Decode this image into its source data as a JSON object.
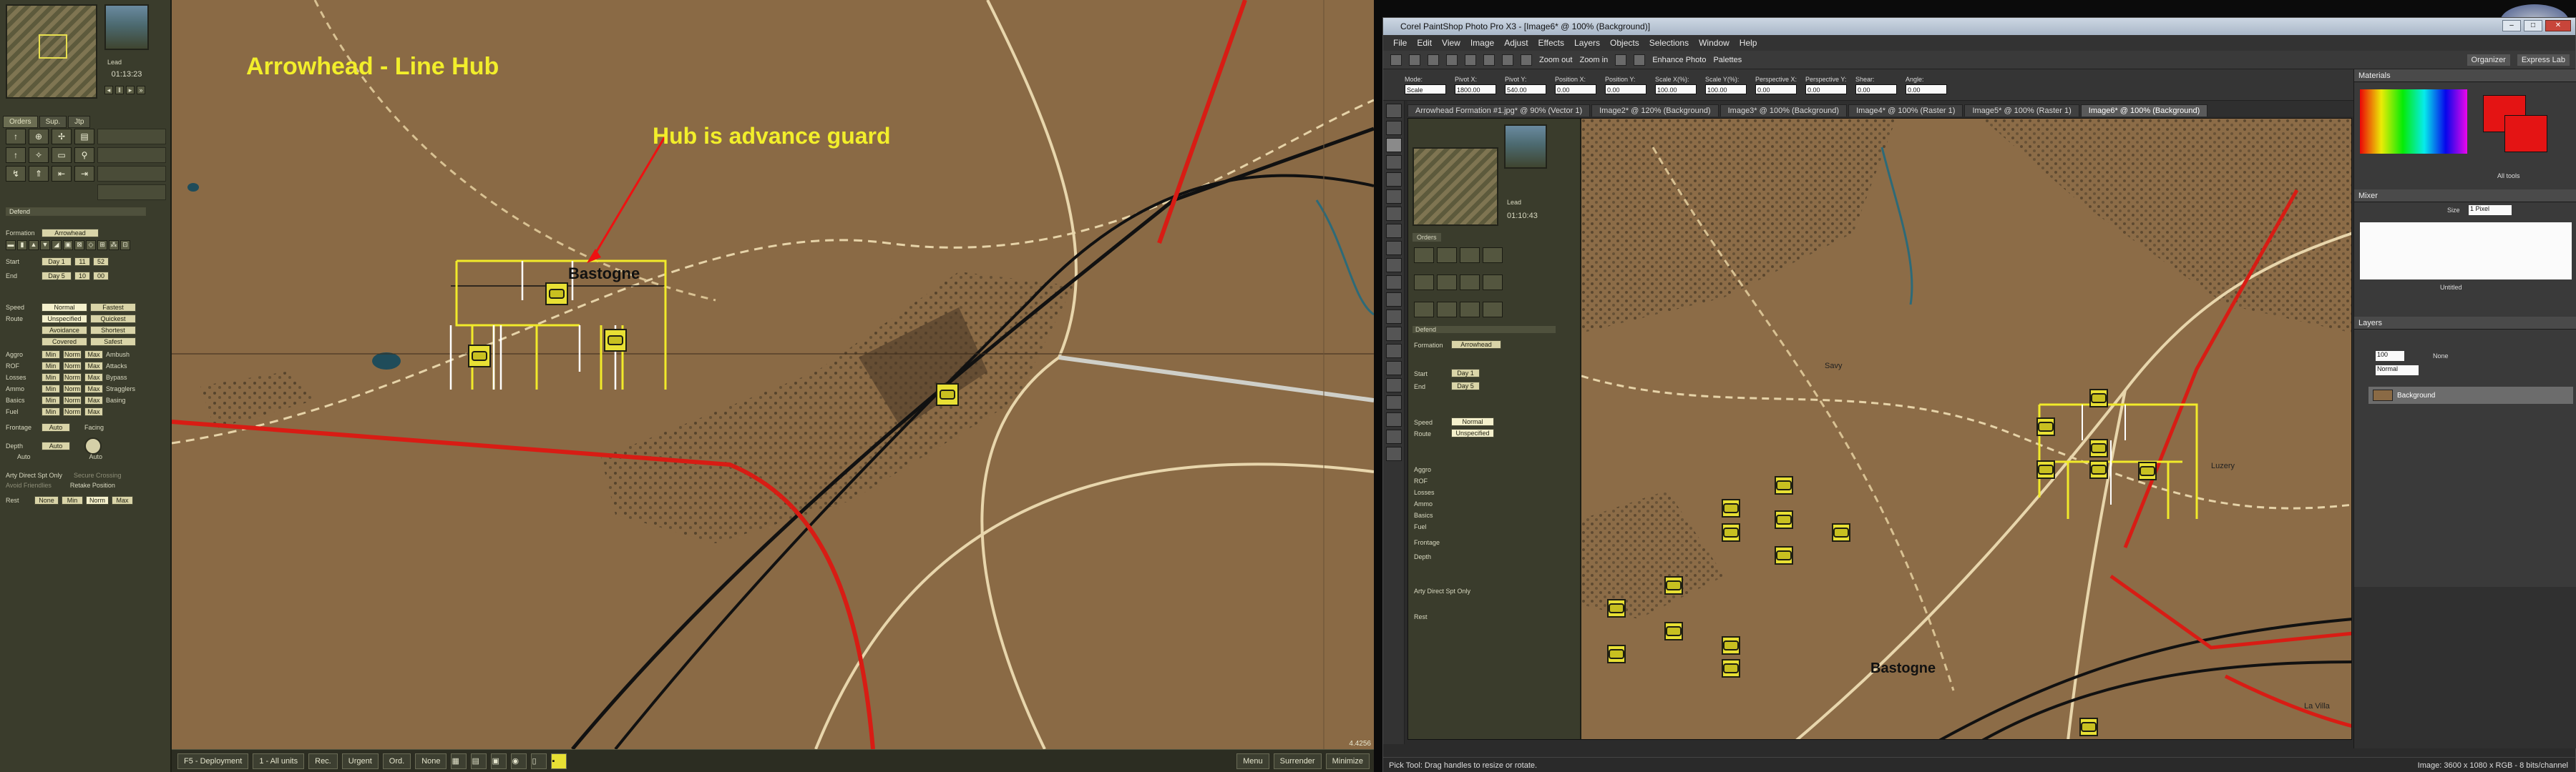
{
  "game": {
    "map_title": "Arrowhead - Line Hub",
    "annotation": "Hub is advance guard",
    "town_label": "Bastogne",
    "map_id": "4.4256",
    "time": "01:13:23",
    "unit_tag": "Lead",
    "panel": {
      "tabs": [
        "Orders",
        "Sup.",
        "Jtp"
      ],
      "order_type": "Defend",
      "formation_label": "Formation",
      "formation_value": "Arrowhead",
      "start_label": "Start",
      "start_values": [
        "Day 1",
        "11",
        "52"
      ],
      "end_label": "End",
      "end_values": [
        "Day 5",
        "10",
        "00"
      ],
      "speed_label": "Speed",
      "speed_values": [
        "Normal",
        "Fastest"
      ],
      "route_label": "Route",
      "route_values": [
        "Unspecified",
        "Quickest",
        "Avoidance",
        "Shortest",
        "Covered",
        "Safest"
      ],
      "aggro_label": "Aggro",
      "rof_label": "ROF",
      "losses_label": "Losses",
      "ammo_label": "Ammo",
      "basics_label": "Basics",
      "fuel_label": "Fuel",
      "levels": [
        "Min",
        "Norm",
        "Max"
      ],
      "checks": [
        "Ambush",
        "Attacks",
        "Bypass",
        "Stragglers",
        "Basing"
      ],
      "frontage_label": "Frontage",
      "depth_label": "Depth",
      "auto": "Auto",
      "facing_label": "Facing",
      "arty_only": "Arty Direct Spt Only",
      "avoid_friendlies": "Avoid Friendlies",
      "secure_crossing": "Secure Crossing",
      "retake_position": "Retake Position",
      "rest_label": "Rest",
      "rest_values": [
        "None",
        "Min",
        "Norm",
        "Max"
      ]
    },
    "bottom": {
      "deployment": "F5 - Deployment",
      "units": "1 - All units",
      "rec": "Rec.",
      "urgent": "Urgent",
      "ord": "Ord.",
      "none": "None",
      "menu": "Menu",
      "surrender": "Surrender",
      "minimize": "Minimize"
    }
  },
  "psp": {
    "title": "Corel PaintShop Photo Pro X3 - [Image6* @ 100% (Background)]",
    "menus": [
      "File",
      "Edit",
      "View",
      "Image",
      "Adjust",
      "Effects",
      "Layers",
      "Objects",
      "Selections",
      "Window",
      "Help"
    ],
    "toolbar_labels": [
      "Zoom out",
      "Zoom in",
      "Enhance Photo",
      "Palettes"
    ],
    "toolbar_right": [
      "Organizer",
      "Express Lab"
    ],
    "options": [
      {
        "label": "Mode:",
        "value": "Scale"
      },
      {
        "label": "Pivot X:",
        "value": "1800.00"
      },
      {
        "label": "Pivot Y:",
        "value": "540.00"
      },
      {
        "label": "Position X:",
        "value": "0.00"
      },
      {
        "label": "Position Y:",
        "value": "0.00"
      },
      {
        "label": "Scale X(%):",
        "value": "100.00"
      },
      {
        "label": "Scale Y(%):",
        "value": "100.00"
      },
      {
        "label": "Perspective X:",
        "value": "0.00"
      },
      {
        "label": "Perspective Y:",
        "value": "0.00"
      },
      {
        "label": "Shear:",
        "value": "0.00"
      },
      {
        "label": "Angle:",
        "value": "0.00"
      }
    ],
    "tabs": [
      "Arrowhead Formation #1.jpg* @ 90% (Vector 1)",
      "Image2* @ 120% (Background)",
      "Image3* @ 100% (Background)",
      "Image4* @ 100% (Raster 1)",
      "Image5* @ 100% (Raster 1)",
      "Image6* @ 100% (Background)"
    ],
    "active_tab": 5,
    "panels": {
      "materials": "Materials",
      "mixer": "Mixer",
      "layers": "Layers",
      "layer_name": "Background",
      "blend_mode": "Normal",
      "opacity": "100",
      "all_tools": "All tools",
      "size_label": "Size",
      "size_value": "1 Pixel",
      "untitled": "Untitled",
      "none": "None"
    },
    "canvas": {
      "time": "01:10:43",
      "unit_tag": "Lead",
      "labels": [
        "Savy",
        "Luzery",
        "Bastogne",
        "La Villa"
      ]
    },
    "status_left": "Pick Tool: Drag handles to resize or rotate.",
    "status_right": "Image: 3600 x 1080 x RGB - 8 bits/channel"
  }
}
